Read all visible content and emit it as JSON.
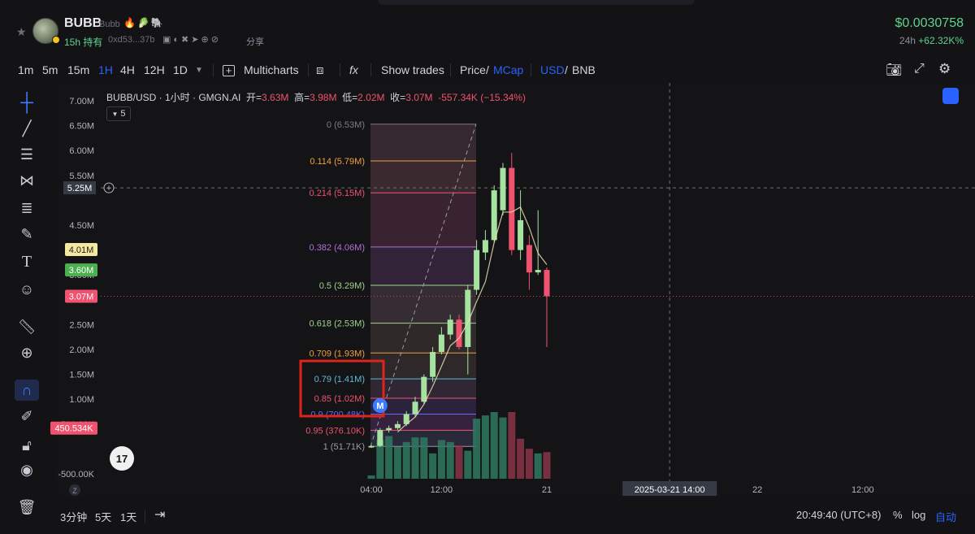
{
  "header": {
    "token_name": "BUBB",
    "token_sub": "Bubb",
    "token_emoji": "🔥🥬🐘",
    "hold_time": "15h 持有",
    "address": "0xd53...37b",
    "share_icons": "▣◐✖➤⊕⊘",
    "share_label": "分享",
    "price": "$0.0030758",
    "change_label": "24h",
    "change_value": "+62.32K%"
  },
  "toolbar": {
    "intervals": [
      "1m",
      "5m",
      "15m",
      "1H",
      "4H",
      "12H",
      "1D"
    ],
    "active_interval": "1H",
    "multicharts": "Multicharts",
    "fx": "fx",
    "show_trades": "Show trades",
    "price": "Price",
    "mcap": "MCap",
    "usd": "USD",
    "bnb": "BNB",
    "slash": "/"
  },
  "legend": {
    "pair": "BUBB/USD · 1小时 · GMGN.AI",
    "open_k": "开=",
    "open_v": "3.63M",
    "high_k": "高=",
    "high_v": "3.98M",
    "low_k": "低=",
    "low_v": "2.02M",
    "close_k": "收=",
    "close_v": "3.07M",
    "change": "-557.34K (−15.34%)",
    "indicator_count": "5"
  },
  "bottom": {
    "ranges": [
      "3分钟",
      "5天",
      "1天"
    ],
    "time": "20:49:40 (UTC+8)",
    "pct": "%",
    "log": "log",
    "auto": "自动"
  },
  "colors": {
    "up": "#a7e3a0",
    "down": "#ef5370",
    "accent": "#2962ff",
    "highlight_box": "#e0231b"
  },
  "chart_data": {
    "type": "candlestick",
    "y_unit": "market cap (USD)",
    "ylim": [
      -600000,
      7300000
    ],
    "y_ticks": [
      {
        "value": 7000000,
        "label": "7.00M"
      },
      {
        "value": 6500000,
        "label": "6.50M"
      },
      {
        "value": 6000000,
        "label": "6.00M"
      },
      {
        "value": 5500000,
        "label": "5.50M"
      },
      {
        "value": 4500000,
        "label": "4.50M"
      },
      {
        "value": 3500000,
        "label": "3.50M"
      },
      {
        "value": 2500000,
        "label": "2.50M"
      },
      {
        "value": 2000000,
        "label": "2.00M"
      },
      {
        "value": 1500000,
        "label": "1.50M"
      },
      {
        "value": 1000000,
        "label": "1.00M"
      },
      {
        "value": 500000,
        "label": "500.00K"
      },
      {
        "value": -500000,
        "label": "-500.00K"
      }
    ],
    "x_ticks": [
      "04:00",
      "12:00",
      "21",
      "22",
      "12:00"
    ],
    "x_tick_hours": [
      4,
      12,
      24,
      48,
      60
    ],
    "crosshair": {
      "x_label": "2025-03-21   14:00",
      "x_hour": 38,
      "y_label": "5.25M",
      "y_value": 5250000
    },
    "price_tags": [
      {
        "label": "4.01M",
        "value": 4010000,
        "style": "yellow"
      },
      {
        "label": "3.60M",
        "value": 3600000,
        "style": "green"
      },
      {
        "label": "3.07M",
        "value": 3070000,
        "style": "red"
      },
      {
        "label": "450.534K",
        "value": 420000,
        "style": "red"
      }
    ],
    "candles_hour_start": 4,
    "candles": [
      {
        "o": 30000,
        "h": 80000,
        "l": 20000,
        "c": 60000
      },
      {
        "o": 60000,
        "h": 420000,
        "l": 40000,
        "c": 380000
      },
      {
        "o": 380000,
        "h": 470000,
        "l": 330000,
        "c": 420000
      },
      {
        "o": 420000,
        "h": 560000,
        "l": 380000,
        "c": 500000
      },
      {
        "o": 500000,
        "h": 760000,
        "l": 460000,
        "c": 700000
      },
      {
        "o": 700000,
        "h": 1050000,
        "l": 640000,
        "c": 950000
      },
      {
        "o": 950000,
        "h": 1500000,
        "l": 900000,
        "c": 1450000
      },
      {
        "o": 1450000,
        "h": 2050000,
        "l": 1350000,
        "c": 1950000
      },
      {
        "o": 1950000,
        "h": 2450000,
        "l": 1900000,
        "c": 2300000
      },
      {
        "o": 2300000,
        "h": 2700000,
        "l": 2200000,
        "c": 2600000
      },
      {
        "o": 2600000,
        "h": 2700000,
        "l": 2000000,
        "c": 2050000
      },
      {
        "o": 2050000,
        "h": 3300000,
        "l": 1500000,
        "c": 3200000
      },
      {
        "o": 3200000,
        "h": 4200000,
        "l": 3100000,
        "c": 4000000
      },
      {
        "o": 3950000,
        "h": 4400000,
        "l": 3800000,
        "c": 4200000
      },
      {
        "o": 4200000,
        "h": 5300000,
        "l": 4150000,
        "c": 5200000
      },
      {
        "o": 4800000,
        "h": 5750000,
        "l": 4700000,
        "c": 5650000
      },
      {
        "o": 5650000,
        "h": 5950000,
        "l": 3900000,
        "c": 4000000
      },
      {
        "o": 4000000,
        "h": 5200000,
        "l": 3800000,
        "c": 4600000
      },
      {
        "o": 4100000,
        "h": 4300000,
        "l": 3200000,
        "c": 3550000
      },
      {
        "o": 3550000,
        "h": 4800000,
        "l": 3500000,
        "c": 3600000
      },
      {
        "o": 3600000,
        "h": 3650000,
        "l": 2050000,
        "c": 3070000
      }
    ],
    "volume_relative": [
      0.05,
      0.58,
      0.64,
      0.48,
      0.55,
      0.62,
      0.62,
      0.38,
      0.58,
      0.55,
      0.5,
      0.42,
      0.9,
      0.95,
      1.0,
      0.92,
      1.0,
      0.6,
      0.45,
      0.38,
      0.4
    ],
    "volume_direction": [
      "up",
      "up",
      "up",
      "up",
      "up",
      "up",
      "up",
      "up",
      "up",
      "up",
      "down",
      "up",
      "up",
      "up",
      "up",
      "up",
      "down",
      "down",
      "down",
      "up",
      "down"
    ],
    "fibonacci": [
      {
        "ratio": "0",
        "label": "0 (6.53M)",
        "value": 6530000,
        "color": "#7a7d86",
        "fill": "#3a2a33"
      },
      {
        "ratio": "0.114",
        "label": "0.114 (5.79M)",
        "value": 5790000,
        "color": "#f0a040",
        "fill": "#3e2b31"
      },
      {
        "ratio": "0.214",
        "label": "0.214 (5.15M)",
        "value": 5150000,
        "color": "#ef5370",
        "fill": "#3e2533"
      },
      {
        "ratio": "0.382",
        "label": "0.382 (4.06M)",
        "value": 4060000,
        "color": "#b36fd6",
        "fill": "#35253d"
      },
      {
        "ratio": "0.5",
        "label": "0.5 (3.29M)",
        "value": 3290000,
        "color": "#9fd38d",
        "fill": "#3a2f37"
      },
      {
        "ratio": "0.618",
        "label": "0.618 (2.53M)",
        "value": 2530000,
        "color": "#9fd38d",
        "fill": "#332b2c"
      },
      {
        "ratio": "0.709",
        "label": "0.709 (1.93M)",
        "value": 1930000,
        "color": "#f0a040",
        "fill": "#322a2e"
      },
      {
        "ratio": "0.79",
        "label": "0.79 (1.41M)",
        "value": 1410000,
        "color": "#5fb8d6",
        "fill": "#332837"
      },
      {
        "ratio": "0.85",
        "label": "0.85 (1.02M)",
        "value": 1020000,
        "color": "#ef5370",
        "fill": "#2e2440"
      },
      {
        "ratio": "0.9",
        "label": "0.9 (700.48K)",
        "value": 700480,
        "color": "#5a6cff",
        "fill": "#3a2444"
      },
      {
        "ratio": "0.95",
        "label": "0.95 (376.10K)",
        "value": 376100,
        "color": "#ef5370",
        "fill": "#2c2b3e"
      },
      {
        "ratio": "1",
        "label": "1 (51.71K)",
        "value": 51710,
        "color": "#9a9da6",
        "fill": ""
      }
    ]
  }
}
